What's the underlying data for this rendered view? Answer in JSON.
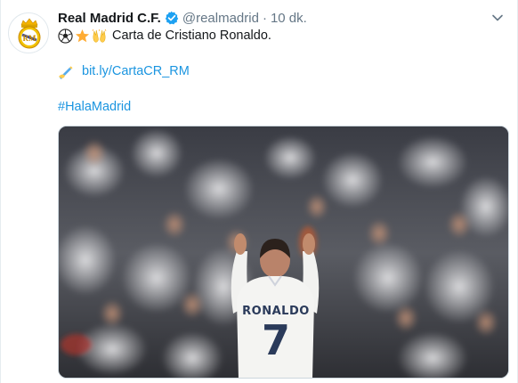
{
  "tweet": {
    "name": "Real Madrid C.F.",
    "handle": "@realmadrid",
    "separator": "·",
    "time": "10 dk.",
    "text": "Carta de Cristiano Ronaldo.",
    "emojis": [
      "soccer-ball-icon",
      "star-icon",
      "raised-hands-icon"
    ],
    "link_emoji": "writing-hand-icon",
    "link": "bit.ly/CartaCR_RM",
    "hashtag": "#HalaMadrid"
  },
  "media": {
    "jersey_name": "RONALDO",
    "jersey_number": "7"
  },
  "colors": {
    "link": "#1b95e0",
    "secondary_text": "#657786",
    "verified": "#1da1f2"
  }
}
